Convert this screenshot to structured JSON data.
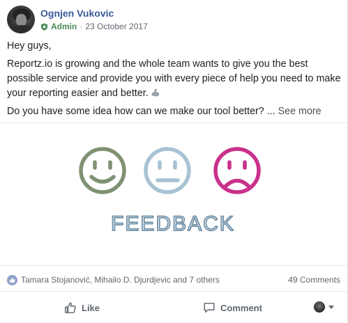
{
  "post": {
    "author": "Ognjen Vukovic",
    "role": "Admin",
    "separator": "·",
    "date": "23 October 2017",
    "paragraphs": {
      "greeting": "Hey guys,",
      "body": "Reportz.io is growing and the whole team wants to give you the best possible service and provide you with every piece of help you need to make your reporting easier and better.",
      "question": "Do you have some idea how can we make our tool better? ..."
    },
    "see_more": "See more",
    "image": {
      "caption": "FEEDBACK",
      "faces": [
        "happy-face",
        "neutral-face",
        "sad-face"
      ],
      "colors": {
        "happy": "#7f9172",
        "neutral": "#a8c2d3",
        "sad": "#c9318a",
        "caption": "#6f90a8"
      }
    }
  },
  "reactions": {
    "reactors": "Tamara Stojanović, Mihailo D. Djurdjevic and 7 others",
    "comments": "49 Comments"
  },
  "actions": {
    "like": "Like",
    "comment": "Comment"
  },
  "colors": {
    "author": "#385898",
    "admin": "#4b8b5a",
    "secondary_text": "#606770",
    "like_badge": "#8ea0c9"
  }
}
